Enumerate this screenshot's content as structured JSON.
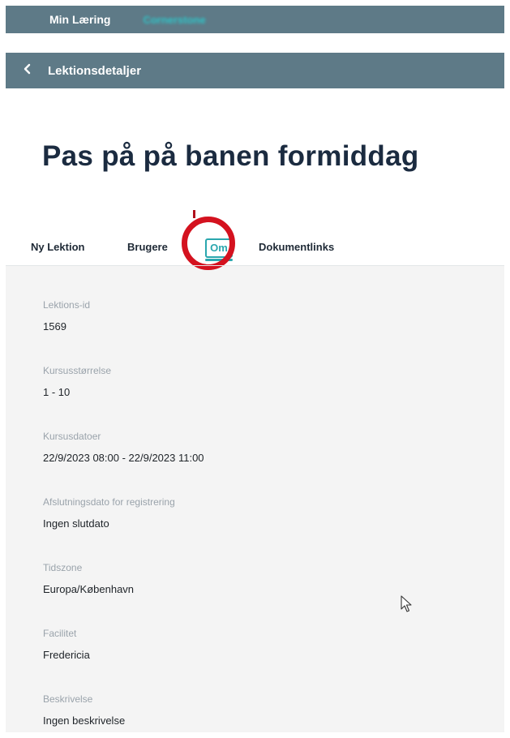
{
  "app": {
    "title": "Min Læring",
    "brand": "Cornerstone"
  },
  "subheader": {
    "back_icon": "chevron-left-icon",
    "title": "Lektionsdetaljer"
  },
  "page": {
    "title": "Pas på på banen formiddag"
  },
  "tabs": [
    {
      "label": "Ny Lektion"
    },
    {
      "label": "Brugere"
    },
    {
      "label": "Om",
      "active": true
    },
    {
      "label": "Dokumentlinks"
    }
  ],
  "details": [
    {
      "label": "Lektions-id",
      "value": "1569"
    },
    {
      "label": "Kursusstørrelse",
      "value": "1 - 10"
    },
    {
      "label": "Kursusdatoer",
      "value": "22/9/2023 08:00 - 22/9/2023 11:00"
    },
    {
      "label": "Afslutningsdato for registrering",
      "value": "Ingen slutdato"
    },
    {
      "label": "Tidszone",
      "value": "Europa/København"
    },
    {
      "label": "Facilitet",
      "value": "Fredericia"
    },
    {
      "label": "Beskrivelse",
      "value": "Ingen beskrivelse"
    }
  ],
  "colors": {
    "bar": "#5e7a87",
    "accent": "#2aa7ae",
    "highlight_ring": "#d4121f",
    "title": "#1b2b40"
  }
}
